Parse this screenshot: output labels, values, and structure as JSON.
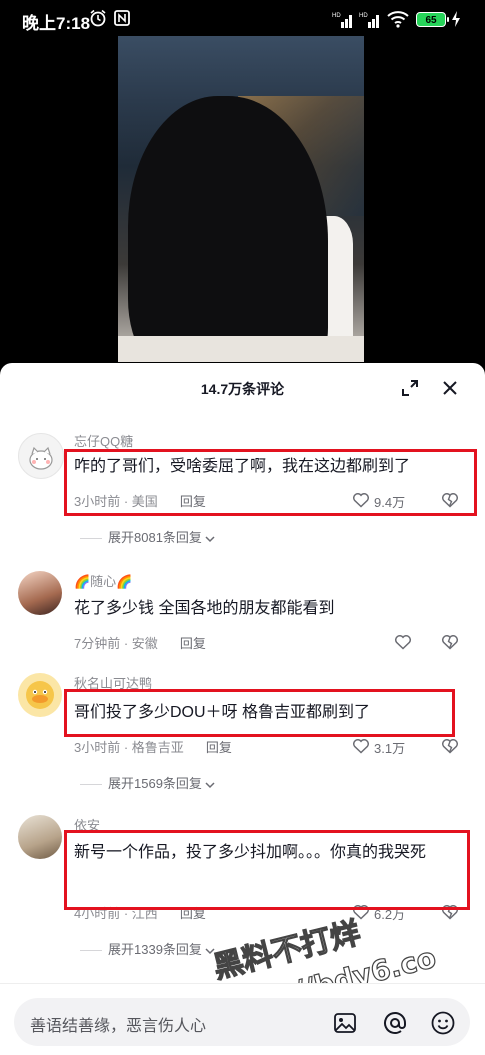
{
  "status_bar": {
    "time": "晚上7:18",
    "battery": "65"
  },
  "comments_header": {
    "title": "14.7万条评论"
  },
  "comments": [
    {
      "username": "忘仔QQ糖",
      "text": "咋的了哥们，受啥委屈了啊，我在这边都刷到了",
      "time": "3小时前",
      "location": "美国",
      "reply_label": "回复",
      "likes": "9.4万",
      "more_replies": "展开8081条回复"
    },
    {
      "username": "🌈随心🌈",
      "text": "花了多少钱 全国各地的朋友都能看到",
      "time": "7分钟前",
      "location": "安徽",
      "reply_label": "回复",
      "likes": "",
      "more_replies": ""
    },
    {
      "username": "秋名山可达鸭",
      "text": "哥们投了多少DOU＋呀  格鲁吉亚都刷到了",
      "time": "3小时前",
      "location": "格鲁吉亚",
      "reply_label": "回复",
      "likes": "3.1万",
      "more_replies": "展开1569条回复"
    },
    {
      "username": "依安",
      "text": "新号一个作品，投了多少抖加啊。。。你真的我哭死",
      "time": "4小时前",
      "location": "江西",
      "reply_label": "回复",
      "likes": "6.2万",
      "more_replies": "展开1339条回复"
    }
  ],
  "input": {
    "placeholder": "善语结善缘，恶言伤人心"
  },
  "watermark": {
    "line1": "黑料不打烊",
    "line2": "https://bdy6.co"
  }
}
